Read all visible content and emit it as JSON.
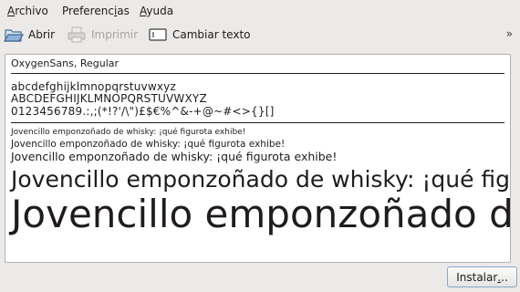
{
  "menu": {
    "archivo": {
      "mnemonic": "A",
      "rest": "rchivo"
    },
    "preferencias": {
      "pre": "Preferenc",
      "mnemonic": "i",
      "rest": "as"
    },
    "ayuda": {
      "mnemonic": "A",
      "rest": "yuda"
    }
  },
  "toolbar": {
    "open_label": "Abrir",
    "print_label": "Imprimir",
    "change_text_label": "Cambiar texto",
    "overflow": "»"
  },
  "preview": {
    "font_name": "OxygenSans, Regular",
    "lowercase": "abcdefghijklmnopqrstuvwxyz",
    "uppercase": "ABCDEFGHIJKLMNOPQRSTUVWXYZ",
    "digits_symbols": "0123456789.:,;(*!?'/\\\")£$€%^&-+@~#<>{}[]",
    "samples": [
      "Jovencillo emponzoñado de whisky: ¡qué figurota exhibe!",
      "Jovencillo emponzoñado de whisky: ¡qué figurota exhibe!",
      "Jovencillo emponzoñado de whisky: ¡qué figurota exhibe!",
      "Jovencillo emponzoñado de whisky: ¡qué figurota exhibe!",
      "Jovencillo emponzoñado de whisky: ¡qué figurota exhibe!"
    ]
  },
  "install": {
    "pre": "Instalar",
    "mnemonic": ".",
    "rest": ".."
  }
}
